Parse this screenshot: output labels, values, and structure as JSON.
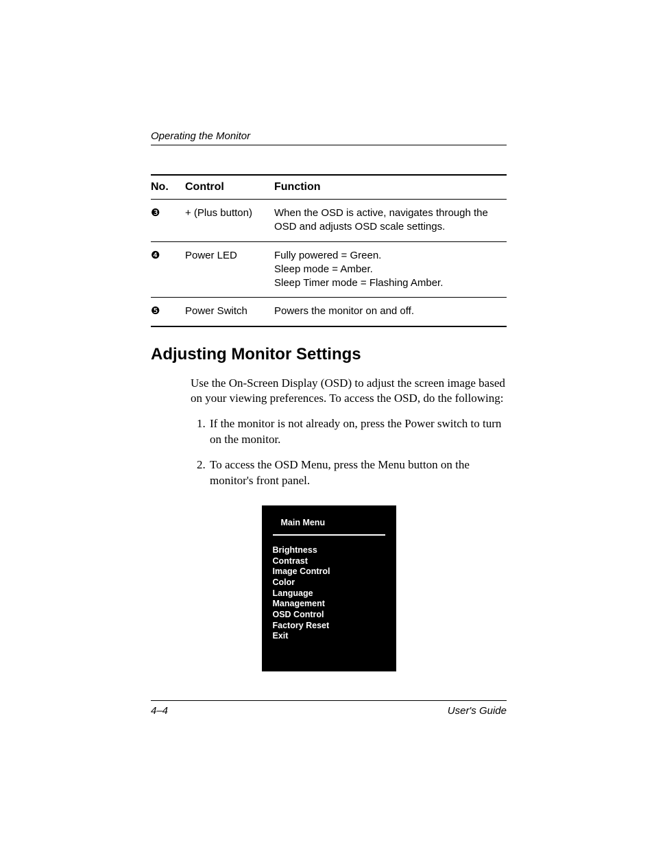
{
  "runningHead": "Operating the Monitor",
  "table": {
    "headers": {
      "no": "No.",
      "control": "Control",
      "function": "Function"
    },
    "rows": [
      {
        "no": "❸",
        "control": "+ (Plus button)",
        "function": "When the OSD is active, navigates through the OSD and adjusts OSD scale settings."
      },
      {
        "no": "❹",
        "control": "Power LED",
        "function": "Fully powered = Green.\nSleep mode = Amber.\nSleep Timer mode = Flashing Amber."
      },
      {
        "no": "❺",
        "control": "Power Switch",
        "function": "Powers the monitor on and off."
      }
    ]
  },
  "sectionHeading": "Adjusting Monitor Settings",
  "intro": "Use the On-Screen Display (OSD) to adjust the screen image based on your viewing preferences. To access the OSD, do the following:",
  "steps": [
    "If the monitor is not already on, press the Power switch to turn on the monitor.",
    "To access the OSD Menu, press the Menu button on the monitor's front panel."
  ],
  "osd": {
    "title": "Main Menu",
    "items": [
      "Brightness",
      "Contrast",
      "Image Control",
      "Color",
      "Language",
      "Management",
      "OSD Control",
      "Factory Reset",
      "Exit"
    ]
  },
  "footer": {
    "pageNum": "4–4",
    "docTitle": "User's Guide"
  }
}
